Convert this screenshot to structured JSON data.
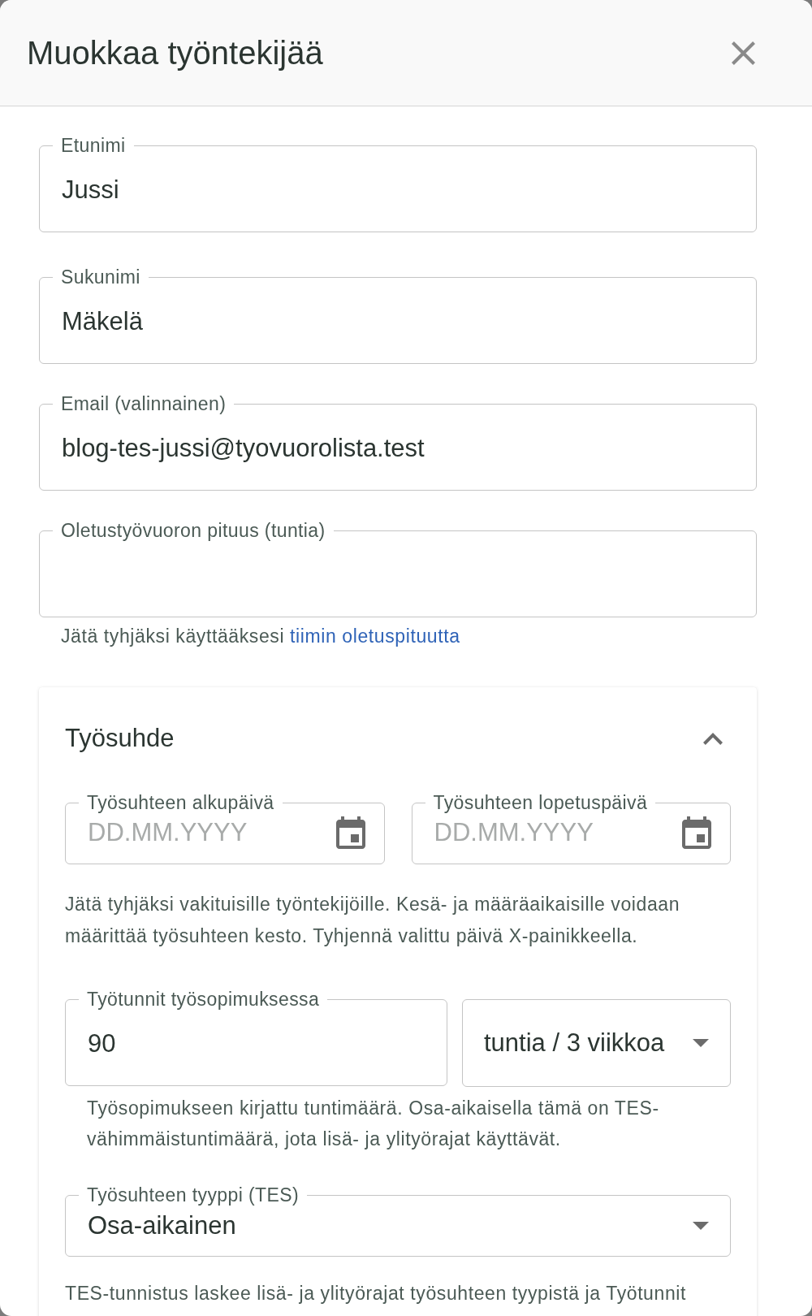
{
  "dialog": {
    "title": "Muokkaa työntekijää"
  },
  "fields": [
    {
      "label": "Etunimi",
      "value": "Jussi"
    },
    {
      "label": "Sukunimi",
      "value": "Mäkelä"
    },
    {
      "label": "Email (valinnainen)",
      "value": "blog-tes-jussi@tyovuorolista.test"
    },
    {
      "label": "Oletustyövuoron pituus (tuntia)",
      "helper": "Jätä tyhjäksi käyttääksesi",
      "helper_link": "tiimin oletuspituutta"
    }
  ],
  "employment_section": {
    "title": "Työsuhde",
    "expanded": true,
    "date_fields": [
      {
        "label": "Työsuhteen alkupäivä",
        "placeholder": "DD.MM.YYYY"
      },
      {
        "label": "Työsuhteen lopetuspäivä",
        "placeholder": "DD.MM.YYYY"
      }
    ],
    "date_help": "Jätä tyhjäksi vakituisille työntekijöille. Kesä- ja määräaikaisille voidaan määrittää työsuhteen kesto. Tyhjennä valittu päivä X-painikkeella.",
    "hours_field": {
      "label": "Työtunnit työsopimuksessa",
      "value": "90"
    },
    "hours_unit_select": {
      "value": "tuntia / 3 viikkoa"
    },
    "hours_help": "Työsopimukseen kirjattu tuntimäärä. Osa-aikaisella tämä on TES-vähimmäistuntimäärä, jota lisä- ja ylityörajat käyttävät.",
    "type_select": {
      "label": "Työsuhteen tyyppi (TES)",
      "value": "Osa-aikainen"
    },
    "type_help": "TES-tunnistus laskee lisä- ja ylityörajat työsuhteen tyypistä ja Työtunnit"
  }
}
